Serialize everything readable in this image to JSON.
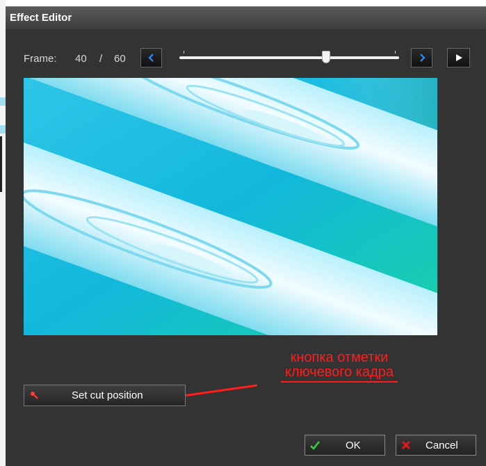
{
  "window": {
    "title": "Effect Editor"
  },
  "frame": {
    "label": "Frame:",
    "current": "40",
    "separator": "/",
    "total": "60",
    "progress": 0.667
  },
  "icons": {
    "prev": "chevron-left-icon",
    "next": "chevron-right-icon",
    "play": "play-icon",
    "cut": "key-icon",
    "ok": "checkmark-icon",
    "cancel": "x-icon"
  },
  "colors": {
    "accent_blue": "#2a8fff",
    "annotation_red": "#ff1d1d",
    "ok_green": "#35d235",
    "cancel_red": "#e11a1a"
  },
  "annotation": {
    "line1": "кнопка отметки",
    "line2": "ключевого кадра"
  },
  "buttons": {
    "set_cut": "Set cut position",
    "ok": "OK",
    "cancel": "Cancel"
  }
}
